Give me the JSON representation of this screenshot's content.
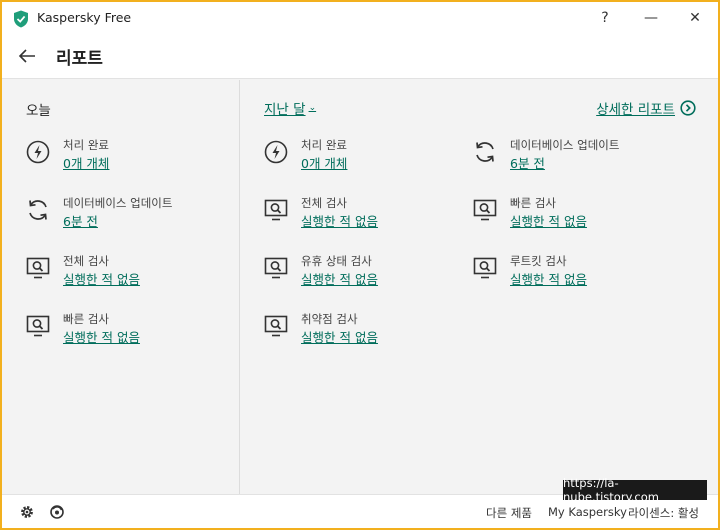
{
  "window": {
    "title": "Kaspersky Free",
    "help": "?",
    "minimize": "—",
    "close": "✕"
  },
  "header": {
    "title": "리포트"
  },
  "today": {
    "title": "오늘",
    "items": [
      {
        "label": "처리 완료",
        "value": "0개 개체",
        "icon": "bolt-icon"
      },
      {
        "label": "데이터베이스 업데이트",
        "value": "6분 전",
        "icon": "refresh-icon"
      },
      {
        "label": "전체 검사",
        "value": "실행한 적 없음",
        "icon": "monitor-scan-icon"
      },
      {
        "label": "빠른 검사",
        "value": "실행한 적 없음",
        "icon": "monitor-scan-icon"
      }
    ]
  },
  "last_month": {
    "period_label": "지난 달",
    "detail_link": "상세한 리포트",
    "col1": [
      {
        "label": "처리 완료",
        "value": "0개 개체",
        "icon": "bolt-icon"
      },
      {
        "label": "전체 검사",
        "value": "실행한 적 없음",
        "icon": "monitor-scan-icon"
      },
      {
        "label": "유휴 상태 검사",
        "value": "실행한 적 없음",
        "icon": "monitor-scan-icon"
      },
      {
        "label": "취약점 검사",
        "value": "실행한 적 없음",
        "icon": "monitor-scan-icon"
      }
    ],
    "col2": [
      {
        "label": "데이터베이스 업데이트",
        "value": "6분 전",
        "icon": "refresh-icon"
      },
      {
        "label": "빠른 검사",
        "value": "실행한 적 없음",
        "icon": "monitor-scan-icon"
      },
      {
        "label": "루트킷 검사",
        "value": "실행한 적 없음",
        "icon": "monitor-scan-icon"
      }
    ]
  },
  "footer": {
    "other_products": "다른 제품",
    "my_kaspersky": "My Kaspersky",
    "license": "라이센스: 활성"
  },
  "watermark": "https://la-nube.tistory.com",
  "colors": {
    "accent": "#006d5b",
    "frame": "#f2b01e",
    "background": "#f3f3f3"
  }
}
